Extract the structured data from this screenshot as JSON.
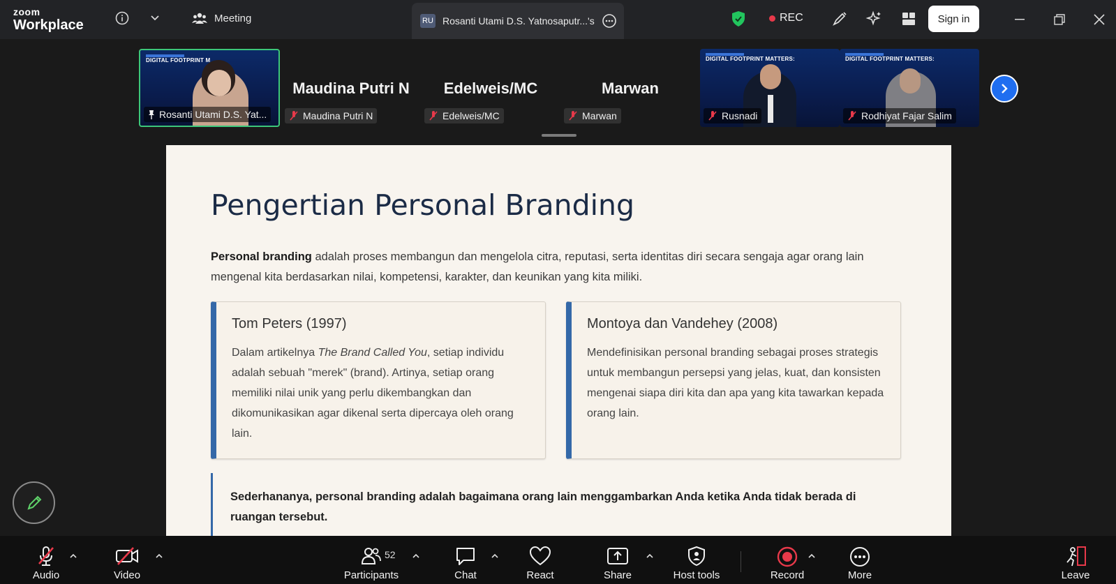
{
  "app": {
    "brand_top": "zoom",
    "brand_bottom": "Workplace"
  },
  "titlebar": {
    "meeting_label": "Meeting",
    "active_tab_initials": "RU",
    "active_tab_label": "Rosanti Utami D.S. Yatnosaputr...'s",
    "rec_label": "REC",
    "signin_label": "Sign in"
  },
  "participants_strip": [
    {
      "name": "Rosanti Utami D.S. Yat...",
      "type": "video",
      "pinned": true,
      "active": true
    },
    {
      "name": "Maudina Putri N",
      "type": "name",
      "big": "Maudina Putri N"
    },
    {
      "name": "Edelweis/MC",
      "type": "name",
      "big": "Edelweis/MC"
    },
    {
      "name": "Marwan",
      "type": "name",
      "big": "Marwan"
    },
    {
      "name": "Rusnadi",
      "type": "video"
    },
    {
      "name": "Rodhiyat Fajar Salim",
      "type": "video"
    }
  ],
  "thumb_slide_header": "DIGITAL FOOTPRINT M",
  "thumb_slide_header2": "DIGITAL FOOTPRINT MATTERS:",
  "slide": {
    "title": "Pengertian Personal Branding",
    "intro_bold": "Personal branding",
    "intro_rest": " adalah proses membangun dan mengelola citra, reputasi, serta identitas diri secara sengaja agar orang lain mengenal kita berdasarkan nilai, kompetensi, karakter, dan keunikan yang kita miliki.",
    "card1": {
      "title": "Tom Peters (1997)",
      "text_pre": "Dalam artikelnya ",
      "text_italic": "The Brand Called You",
      "text_post": ", setiap individu adalah sebuah \"merek\" (brand). Artinya, setiap orang memiliki nilai unik yang perlu dikembangkan dan dikomunikasikan agar dikenal serta dipercaya oleh orang lain."
    },
    "card2": {
      "title": "Montoya dan Vandehey (2008)",
      "text": "Mendefinisikan personal branding sebagai proses strategis untuk membangun persepsi yang jelas, kuat, dan konsisten mengenai siapa diri kita dan apa yang kita tawarkan kepada orang lain."
    },
    "quote": "Sederhananya, personal branding adalah bagaimana orang lain menggambarkan Anda ketika Anda tidak berada di ruangan tersebut."
  },
  "toolbar": {
    "audio": "Audio",
    "video": "Video",
    "participants": "Participants",
    "participants_count": "52",
    "chat": "Chat",
    "react": "React",
    "share": "Share",
    "host_tools": "Host tools",
    "record": "Record",
    "more": "More",
    "leave": "Leave"
  },
  "colors": {
    "accent": "#3468a8",
    "record": "#e8394a",
    "active_border": "#3cc77a",
    "next": "#1f6ef0"
  }
}
